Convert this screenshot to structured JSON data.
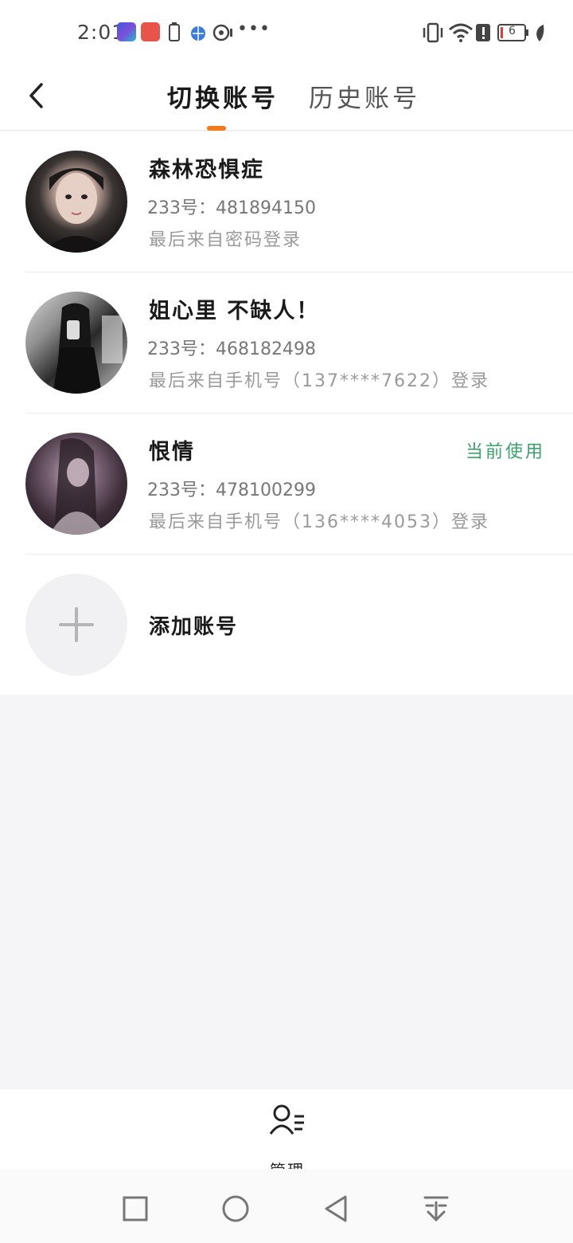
{
  "status_bar": {
    "time": "2:01",
    "more": "•••",
    "battery": "6",
    "icons": [
      "app-icon-dark",
      "app-icon-red",
      "battery-small-icon",
      "globe-icon",
      "location-icon",
      "vibrate-icon",
      "wifi-icon",
      "alert-icon",
      "battery-icon",
      "leaf-icon"
    ]
  },
  "header": {
    "back_icon": "chevron-left-icon",
    "tabs": [
      {
        "label": "切换账号",
        "active": true
      },
      {
        "label": "历史账号",
        "active": false
      }
    ],
    "accent_color": "#f07b1d"
  },
  "accounts": [
    {
      "name": "森林恐惧症",
      "id": "233号：481894150",
      "login": "最后来自密码登录",
      "current": ""
    },
    {
      "name": "姐心里 不缺人！",
      "id": "233号：468182498",
      "login": "最后来自手机号（137****7622）登录",
      "current": ""
    },
    {
      "name": "恨情",
      "id": "233号：478100299",
      "login": "最后来自手机号（136****4053）登录",
      "current": "当前使用"
    }
  ],
  "add_account": {
    "label": "添加账号",
    "icon": "plus-icon"
  },
  "bottom": {
    "manage_label": "管理",
    "manage_icon": "user-manage-icon"
  },
  "nav": {
    "icons": [
      "square-icon",
      "circle-icon",
      "triangle-back-icon",
      "download-icon"
    ]
  },
  "colors": {
    "current_green": "#3aa36a"
  }
}
